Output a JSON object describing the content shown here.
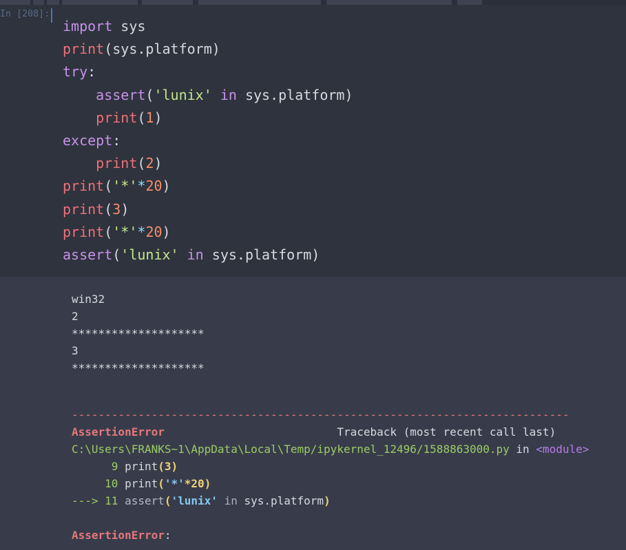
{
  "cell": {
    "prompt": "In [208]:",
    "code": {
      "l1": [
        "import",
        " sys"
      ],
      "l2": [
        "print",
        "(sys.platform)"
      ],
      "l3": [
        "try",
        ":"
      ],
      "l4": [
        "    ",
        "assert",
        "(",
        "'lunix'",
        " ",
        "in",
        " sys.platform)"
      ],
      "l5": [
        "    ",
        "print",
        "(",
        "1",
        ")"
      ],
      "l6": [
        "except",
        ":"
      ],
      "l7": [
        "    ",
        "print",
        "(",
        "2",
        ")"
      ],
      "l8": [
        "print",
        "(",
        "'*'",
        "*",
        "20",
        ")"
      ],
      "l9": [
        "print",
        "(",
        "3",
        ")"
      ],
      "l10": [
        "print",
        "(",
        "'*'",
        "*",
        "20",
        ")"
      ],
      "l11": [
        "assert",
        "(",
        "'lunix'",
        " ",
        "in",
        " sys.platform)"
      ]
    }
  },
  "output": {
    "stdout": [
      "win32",
      "2",
      "********************",
      "3",
      "********************"
    ]
  },
  "traceback": {
    "separator": "---------------------------------------------------------------------------",
    "error_name": "AssertionError",
    "header_gap": "                          ",
    "header_right": "Traceback (most recent call last)",
    "path": "C:\\Users\\FRANKS~1\\AppData\\Local\\Temp/ipykernel_12496/1588863000.py",
    "in_word": " in ",
    "module": "<module>",
    "line9": {
      "num": "      9 ",
      "fn": "print",
      "open": "(",
      "val": "3",
      "close": ")"
    },
    "line10": {
      "num": "     10 ",
      "fn": "print",
      "open": "(",
      "str": "'*'",
      "op": "*",
      "val": "20",
      "close": ")"
    },
    "line11": {
      "arrow": "---> 11 ",
      "fn": "assert",
      "open": "(",
      "str": "'lunix'",
      "in": " in ",
      "rest": "sys.platform",
      "close": ")"
    },
    "final_error": "AssertionError",
    "final_colon": ":"
  }
}
